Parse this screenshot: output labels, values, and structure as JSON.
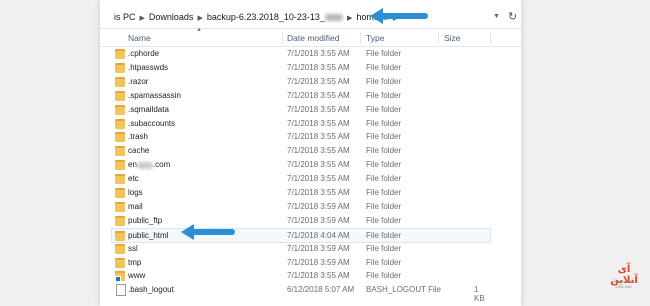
{
  "address": {
    "parts": [
      "is PC",
      "Downloads",
      "backup-6.23.2018_10-23-13_",
      "homedir"
    ],
    "refresh_icon": "refresh-icon"
  },
  "columns": {
    "name": "Name",
    "date": "Date modified",
    "type": "Type",
    "size": "Size"
  },
  "files": [
    {
      "name": ".cphorde",
      "date": "7/1/2018 3:55 AM",
      "type": "File folder",
      "size": "",
      "icon": "folder-icon"
    },
    {
      "name": ".htpasswds",
      "date": "7/1/2018 3:55 AM",
      "type": "File folder",
      "size": "",
      "icon": "folder-icon"
    },
    {
      "name": ".razor",
      "date": "7/1/2018 3:55 AM",
      "type": "File folder",
      "size": "",
      "icon": "folder-icon"
    },
    {
      "name": ".spamassassin",
      "date": "7/1/2018 3:55 AM",
      "type": "File folder",
      "size": "",
      "icon": "folder-icon"
    },
    {
      "name": ".sqmaildata",
      "date": "7/1/2018 3:55 AM",
      "type": "File folder",
      "size": "",
      "icon": "folder-icon"
    },
    {
      "name": ".subaccounts",
      "date": "7/1/2018 3:55 AM",
      "type": "File folder",
      "size": "",
      "icon": "folder-icon"
    },
    {
      "name": ".trash",
      "date": "7/1/2018 3:55 AM",
      "type": "File folder",
      "size": "",
      "icon": "folder-icon"
    },
    {
      "name": "cache",
      "date": "7/1/2018 3:55 AM",
      "type": "File folder",
      "size": "",
      "icon": "folder-icon"
    },
    {
      "name": "en",
      "name_suffix": ".com",
      "date": "7/1/2018 3:55 AM",
      "type": "File folder",
      "size": "",
      "icon": "folder-icon"
    },
    {
      "name": "etc",
      "date": "7/1/2018 3:55 AM",
      "type": "File folder",
      "size": "",
      "icon": "folder-icon"
    },
    {
      "name": "logs",
      "date": "7/1/2018 3:55 AM",
      "type": "File folder",
      "size": "",
      "icon": "folder-icon"
    },
    {
      "name": "mail",
      "date": "7/1/2018 3:59 AM",
      "type": "File folder",
      "size": "",
      "icon": "folder-icon"
    },
    {
      "name": "public_ftp",
      "date": "7/1/2018 3:59 AM",
      "type": "File folder",
      "size": "",
      "icon": "folder-icon"
    },
    {
      "name": "public_html",
      "date": "7/1/2018 4:04 AM",
      "type": "File folder",
      "size": "",
      "icon": "folder-icon",
      "selected": true
    },
    {
      "name": "ssl",
      "date": "7/1/2018 3:59 AM",
      "type": "File folder",
      "size": "",
      "icon": "folder-icon"
    },
    {
      "name": "tmp",
      "date": "7/1/2018 3:59 AM",
      "type": "File folder",
      "size": "",
      "icon": "folder-icon"
    },
    {
      "name": "www",
      "date": "7/1/2018 3:55 AM",
      "type": "File folder",
      "size": "",
      "icon": "folder-shortcut-icon"
    },
    {
      "name": ".bash_logout",
      "date": "6/12/2018 5:07 AM",
      "type": "BASH_LOGOUT File",
      "size": "1 KB",
      "icon": "file-icon"
    }
  ],
  "logo": {
    "text": "آی آنلاین",
    "tagline": "IRANHOST ONLINE"
  },
  "colors": {
    "arrow": "#2a8fd4",
    "folder": "#f2c55c",
    "selected_row": "#f3f8fd"
  }
}
